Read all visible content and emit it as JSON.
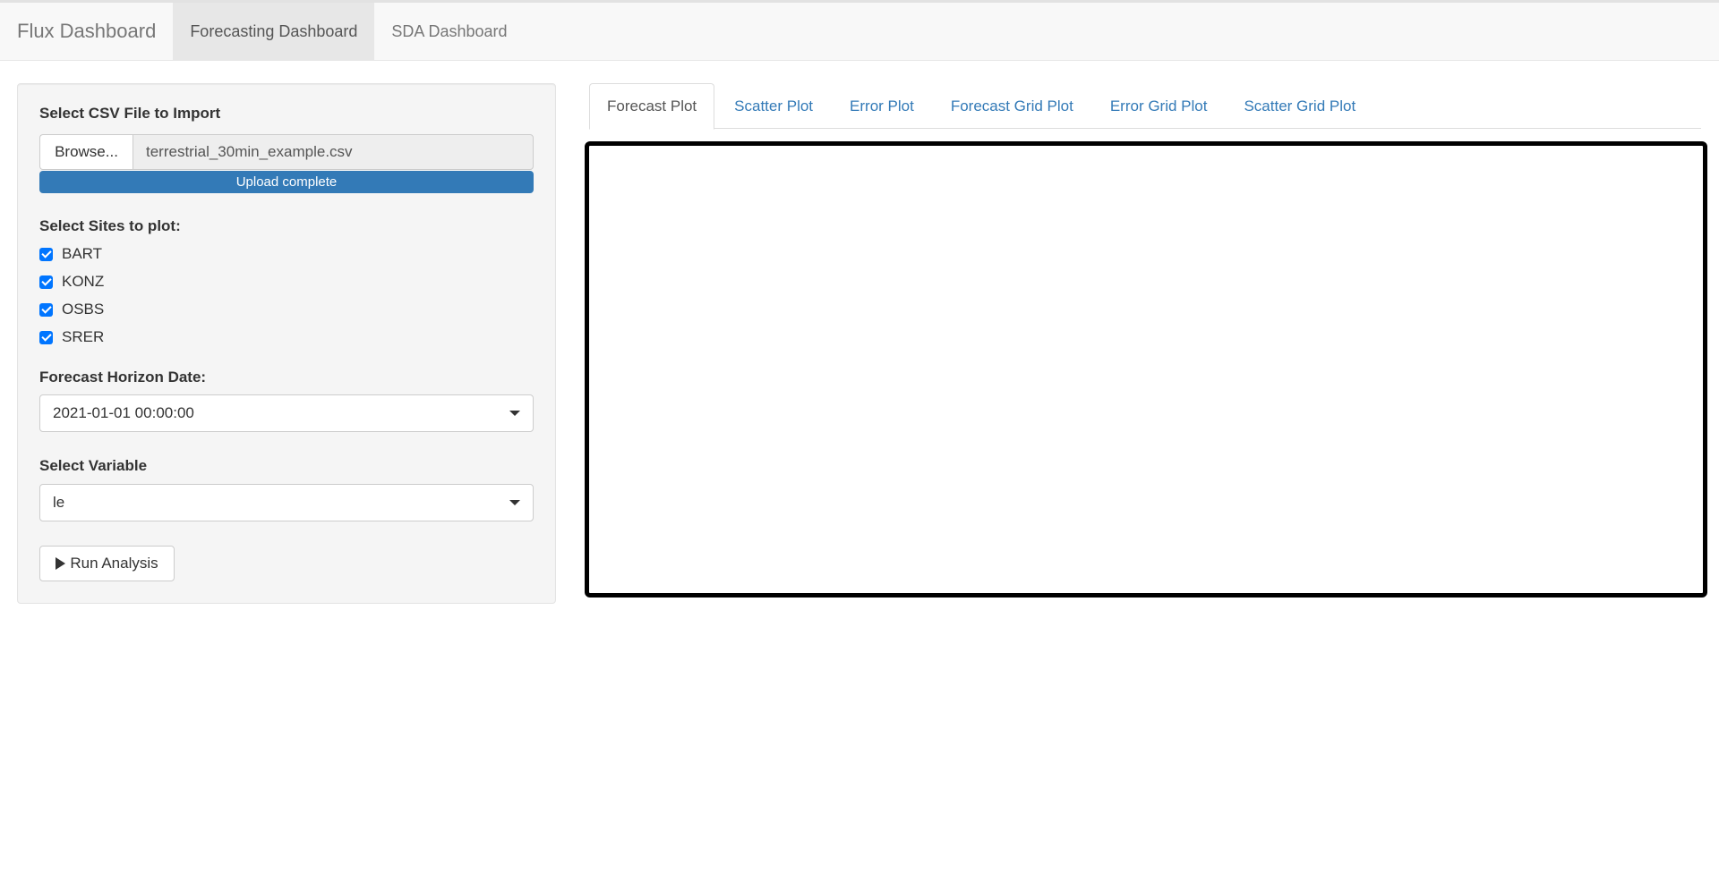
{
  "navbar": {
    "brand": "Flux Dashboard",
    "items": [
      {
        "label": "Forecasting Dashboard",
        "active": true
      },
      {
        "label": "SDA Dashboard",
        "active": false
      }
    ]
  },
  "sidebar": {
    "file_input": {
      "label": "Select CSV File to Import",
      "browse_label": "Browse...",
      "file_name": "terrestrial_30min_example.csv",
      "progress_text": "Upload complete",
      "progress_percent": 100
    },
    "sites": {
      "label": "Select Sites to plot:",
      "options": [
        {
          "name": "BART",
          "checked": true
        },
        {
          "name": "KONZ",
          "checked": true
        },
        {
          "name": "OSBS",
          "checked": true
        },
        {
          "name": "SRER",
          "checked": true
        }
      ]
    },
    "horizon": {
      "label": "Forecast Horizon Date:",
      "value": "2021-01-01 00:00:00"
    },
    "variable": {
      "label": "Select Variable",
      "value": "le"
    },
    "run_button": {
      "label": "Run Analysis"
    }
  },
  "main": {
    "tabs": [
      {
        "label": "Forecast Plot",
        "active": true
      },
      {
        "label": "Scatter Plot",
        "active": false
      },
      {
        "label": "Error Plot",
        "active": false
      },
      {
        "label": "Forecast Grid Plot",
        "active": false
      },
      {
        "label": "Error Grid Plot",
        "active": false
      },
      {
        "label": "Scatter Grid Plot",
        "active": false
      }
    ]
  },
  "colors": {
    "accent": "#337ab7",
    "checkbox": "#0075ff",
    "plot_border": "#000000"
  }
}
